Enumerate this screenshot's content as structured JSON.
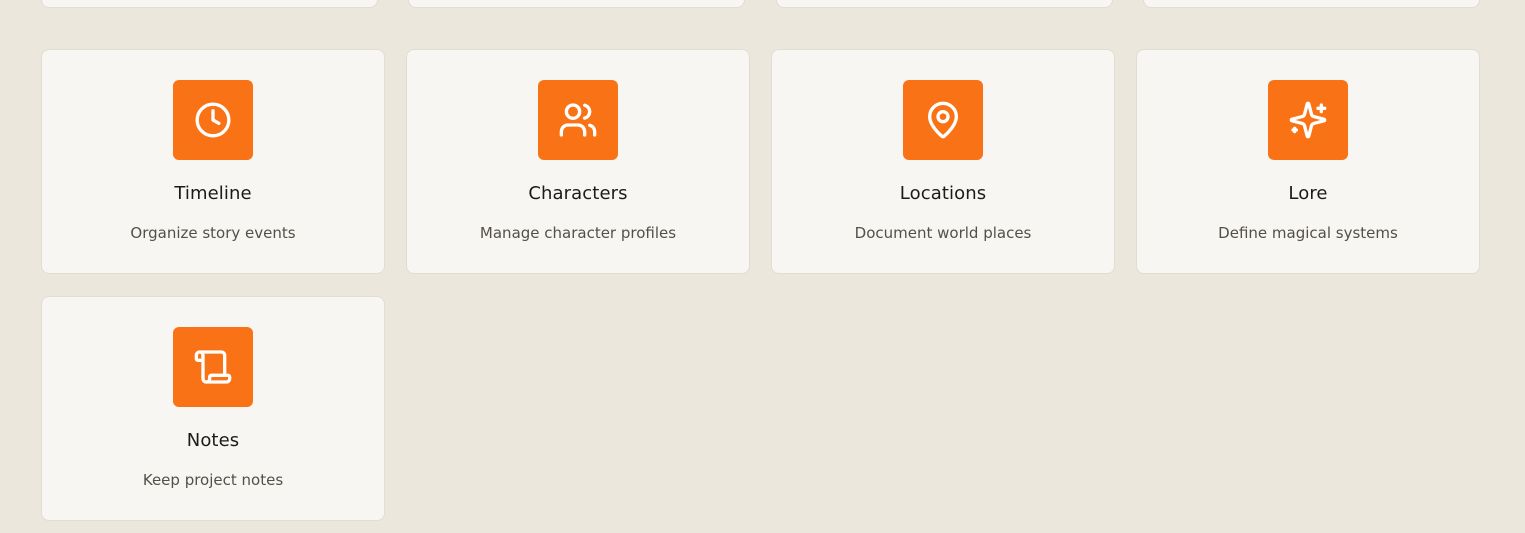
{
  "theme": {
    "accent": "#f97316",
    "background": "#ece7dd",
    "card_background": "#f7f6f2"
  },
  "cards": [
    {
      "title": "Timeline",
      "description": "Organize story events",
      "icon": "clock-icon"
    },
    {
      "title": "Characters",
      "description": "Manage character profiles",
      "icon": "users-icon"
    },
    {
      "title": "Locations",
      "description": "Document world places",
      "icon": "map-pin-icon"
    },
    {
      "title": "Lore",
      "description": "Define magical systems",
      "icon": "sparkles-icon"
    },
    {
      "title": "Notes",
      "description": "Keep project notes",
      "icon": "scroll-icon"
    }
  ]
}
